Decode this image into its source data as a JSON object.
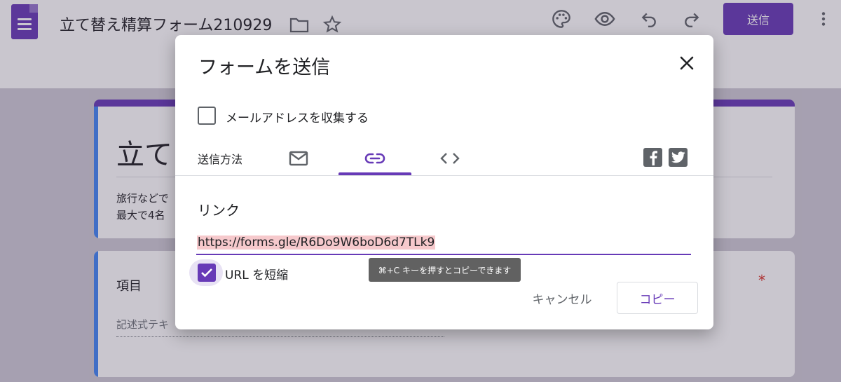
{
  "app": {
    "doc_title": "立て替え精算フォーム210929",
    "send_button": "送信",
    "icons": [
      "forms-logo-icon",
      "folder-icon",
      "star-icon",
      "palette-icon",
      "preview-eye-icon",
      "undo-icon",
      "redo-icon",
      "more-vert-icon"
    ]
  },
  "background": {
    "title_card": {
      "title": "立て",
      "desc_line1": "旅行などで",
      "desc_line2": "最大で4名"
    },
    "question_card": {
      "title": "項目",
      "placeholder": "記述式テキ",
      "required_mark": "*"
    }
  },
  "dialog": {
    "title": "フォームを送信",
    "collect_email_label": "メールアドレスを収集する",
    "collect_email_checked": false,
    "send_via_label": "送信方法",
    "tabs": [
      {
        "icon": "email-icon",
        "active": false
      },
      {
        "icon": "link-icon",
        "active": true
      },
      {
        "icon": "embed-code-icon",
        "active": false
      }
    ],
    "social": [
      "facebook-icon",
      "twitter-icon"
    ],
    "link_section_label": "リンク",
    "url": "https://forms.gle/R6Do9W6boD6d7TLk9",
    "shorten_url_label": "URL を短縮",
    "shorten_url_checked": true,
    "tooltip": "⌘+C キーを押すとコピーできます",
    "cancel_button": "キャンセル",
    "copy_button": "コピー"
  },
  "colors": {
    "accent": "#673ab7",
    "secondary_accent": "#4285f4",
    "tooltip_bg": "#616161",
    "selection_highlight": "#f6c9cc"
  }
}
